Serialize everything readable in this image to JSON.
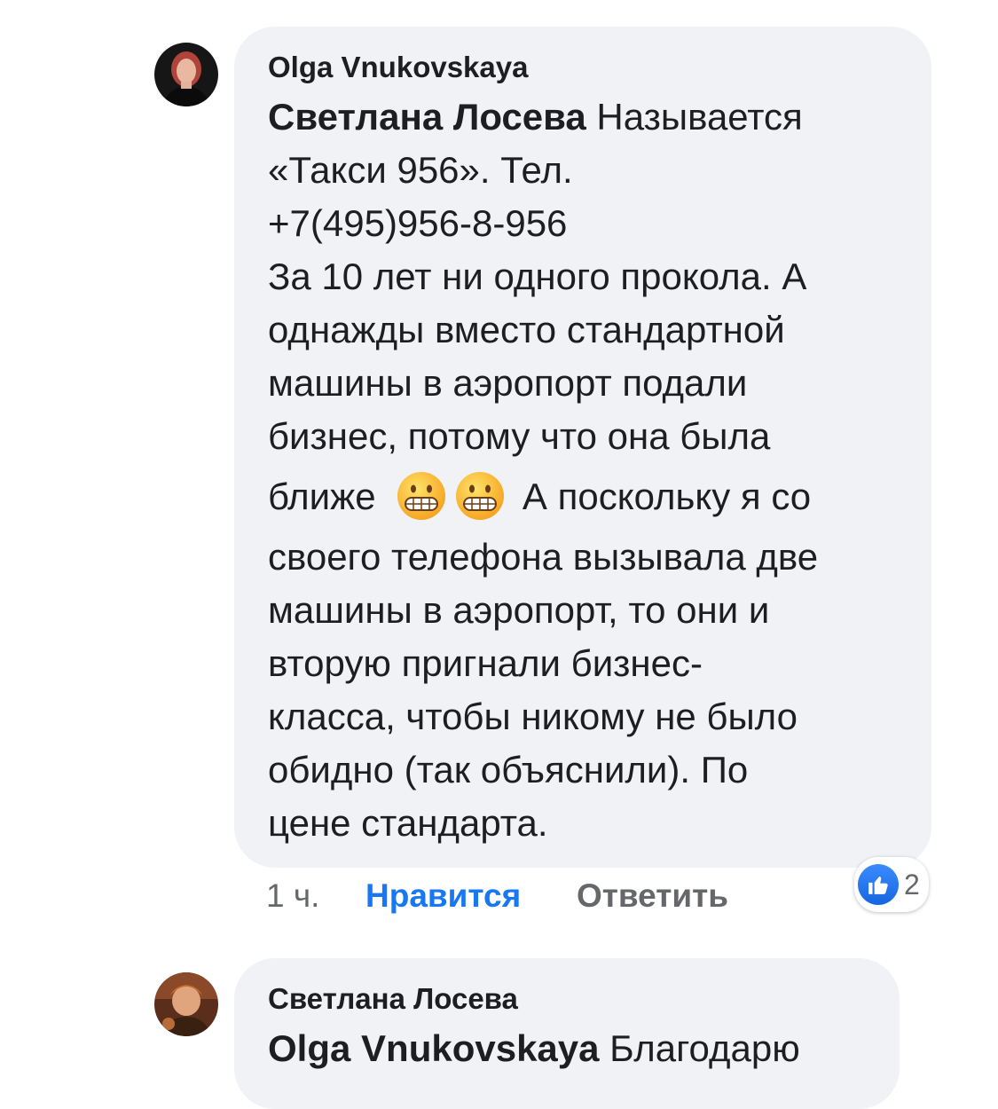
{
  "comment1": {
    "author": "Olga Vnukovskaya",
    "mention": "Светлана Лосева",
    "lines": [
      " Называется",
      "«Такси 956». Тел.",
      "+7(495)956-8-956",
      "За 10 лет ни одного прокола. А",
      "однажды вместо стандартной",
      "машины в аэропорт подали",
      "бизнес, потому что  она была",
      "ближе",
      " А поскольку я со",
      "своего телефона вызывала две",
      "машины в аэропорт, то они и",
      "вторую пригнали бизнес-",
      "класса, чтобы никому не было",
      "обидно (так объяснили). По",
      "цене стандарта."
    ],
    "emoji": [
      "grimacing-face",
      "grimacing-face"
    ],
    "time": "1 ч.",
    "like_label": "Нравится",
    "reply_label": "Ответить",
    "reaction_count": "2"
  },
  "comment2": {
    "author": "Светлана Лосева",
    "mention": "Olga Vnukovskaya",
    "text": " Благодарю"
  },
  "colors": {
    "bubble": "#f0f2f5",
    "link_blue": "#1877f2",
    "meta_gray": "#65676b",
    "text": "#1c1e21"
  }
}
